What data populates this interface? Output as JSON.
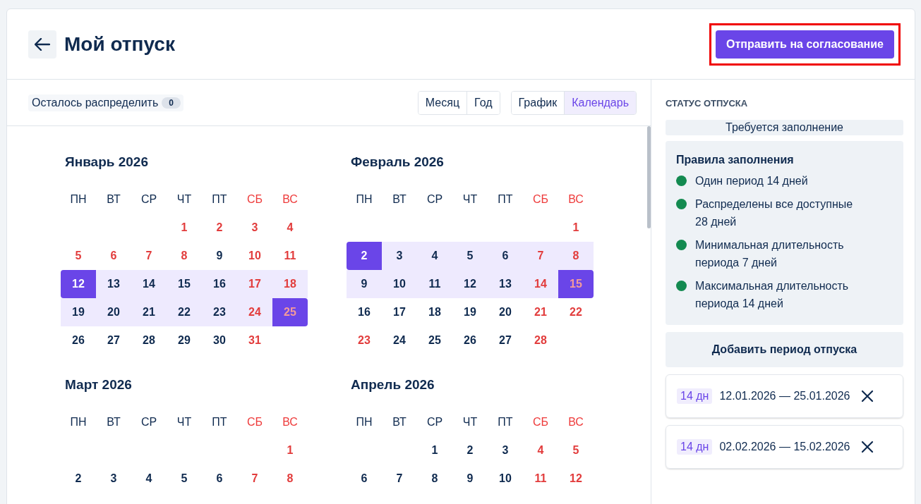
{
  "header": {
    "title": "Мой отпуск",
    "submit_button": "Отправить на согласование",
    "submit_highlighted": true
  },
  "toolbar": {
    "remaining_label": "Осталось распределить",
    "remaining_count": "0",
    "scale_tabs": [
      {
        "label": "Месяц",
        "selected": false
      },
      {
        "label": "Год",
        "selected": false
      }
    ],
    "view_tabs": [
      {
        "label": "График",
        "selected": false
      },
      {
        "label": "Календарь",
        "selected": true
      }
    ]
  },
  "months": [
    {
      "title": "Январь 2026",
      "weekdays": [
        {
          "label": "ПН",
          "weekend": false
        },
        {
          "label": "ВТ",
          "weekend": false
        },
        {
          "label": "СР",
          "weekend": false
        },
        {
          "label": "ЧТ",
          "weekend": false
        },
        {
          "label": "ПТ",
          "weekend": false
        },
        {
          "label": "СБ",
          "weekend": true
        },
        {
          "label": "ВС",
          "weekend": true
        }
      ],
      "weeks": [
        {
          "days": [
            {
              "kind": "blank"
            },
            {
              "kind": "blank"
            },
            {
              "kind": "blank"
            },
            {
              "kind": "day",
              "n": "1",
              "holiday": true,
              "in_range": false,
              "selected": false
            },
            {
              "kind": "day",
              "n": "2",
              "holiday": true,
              "in_range": false,
              "selected": false
            },
            {
              "kind": "day",
              "n": "3",
              "holiday": true,
              "in_range": false,
              "selected": false
            },
            {
              "kind": "day",
              "n": "4",
              "holiday": true,
              "in_range": false,
              "selected": false
            }
          ]
        },
        {
          "days": [
            {
              "kind": "day",
              "n": "5",
              "holiday": true,
              "in_range": false,
              "selected": false
            },
            {
              "kind": "day",
              "n": "6",
              "holiday": true,
              "in_range": false,
              "selected": false
            },
            {
              "kind": "day",
              "n": "7",
              "holiday": true,
              "in_range": false,
              "selected": false
            },
            {
              "kind": "day",
              "n": "8",
              "holiday": true,
              "in_range": false,
              "selected": false
            },
            {
              "kind": "day",
              "n": "9",
              "holiday": false,
              "in_range": false,
              "selected": false
            },
            {
              "kind": "day",
              "n": "10",
              "holiday": true,
              "in_range": false,
              "selected": false
            },
            {
              "kind": "day",
              "n": "11",
              "holiday": true,
              "in_range": false,
              "selected": false
            }
          ]
        },
        {
          "days": [
            {
              "kind": "day",
              "n": "12",
              "holiday": false,
              "in_range": true,
              "selected": true
            },
            {
              "kind": "day",
              "n": "13",
              "holiday": false,
              "in_range": true,
              "selected": false
            },
            {
              "kind": "day",
              "n": "14",
              "holiday": false,
              "in_range": true,
              "selected": false
            },
            {
              "kind": "day",
              "n": "15",
              "holiday": false,
              "in_range": true,
              "selected": false
            },
            {
              "kind": "day",
              "n": "16",
              "holiday": false,
              "in_range": true,
              "selected": false
            },
            {
              "kind": "day",
              "n": "17",
              "holiday": true,
              "in_range": true,
              "selected": false
            },
            {
              "kind": "day",
              "n": "18",
              "holiday": true,
              "in_range": true,
              "selected": false
            }
          ]
        },
        {
          "days": [
            {
              "kind": "day",
              "n": "19",
              "holiday": false,
              "in_range": true,
              "selected": false
            },
            {
              "kind": "day",
              "n": "20",
              "holiday": false,
              "in_range": true,
              "selected": false
            },
            {
              "kind": "day",
              "n": "21",
              "holiday": false,
              "in_range": true,
              "selected": false
            },
            {
              "kind": "day",
              "n": "22",
              "holiday": false,
              "in_range": true,
              "selected": false
            },
            {
              "kind": "day",
              "n": "23",
              "holiday": false,
              "in_range": true,
              "selected": false
            },
            {
              "kind": "day",
              "n": "24",
              "holiday": true,
              "in_range": true,
              "selected": false
            },
            {
              "kind": "day",
              "n": "25",
              "holiday": true,
              "in_range": true,
              "selected": true
            }
          ]
        },
        {
          "days": [
            {
              "kind": "day",
              "n": "26",
              "holiday": false,
              "in_range": false,
              "selected": false
            },
            {
              "kind": "day",
              "n": "27",
              "holiday": false,
              "in_range": false,
              "selected": false
            },
            {
              "kind": "day",
              "n": "28",
              "holiday": false,
              "in_range": false,
              "selected": false
            },
            {
              "kind": "day",
              "n": "29",
              "holiday": false,
              "in_range": false,
              "selected": false
            },
            {
              "kind": "day",
              "n": "30",
              "holiday": false,
              "in_range": false,
              "selected": false
            },
            {
              "kind": "day",
              "n": "31",
              "holiday": true,
              "in_range": false,
              "selected": false
            },
            {
              "kind": "blank"
            }
          ]
        }
      ]
    },
    {
      "title": "Февраль 2026",
      "weekdays": [
        {
          "label": "ПН",
          "weekend": false
        },
        {
          "label": "ВТ",
          "weekend": false
        },
        {
          "label": "СР",
          "weekend": false
        },
        {
          "label": "ЧТ",
          "weekend": false
        },
        {
          "label": "ПТ",
          "weekend": false
        },
        {
          "label": "СБ",
          "weekend": true
        },
        {
          "label": "ВС",
          "weekend": true
        }
      ],
      "weeks": [
        {
          "days": [
            {
              "kind": "blank"
            },
            {
              "kind": "blank"
            },
            {
              "kind": "blank"
            },
            {
              "kind": "blank"
            },
            {
              "kind": "blank"
            },
            {
              "kind": "blank"
            },
            {
              "kind": "day",
              "n": "1",
              "holiday": true,
              "in_range": false,
              "selected": false
            }
          ]
        },
        {
          "days": [
            {
              "kind": "day",
              "n": "2",
              "holiday": false,
              "in_range": true,
              "selected": true
            },
            {
              "kind": "day",
              "n": "3",
              "holiday": false,
              "in_range": true,
              "selected": false
            },
            {
              "kind": "day",
              "n": "4",
              "holiday": false,
              "in_range": true,
              "selected": false
            },
            {
              "kind": "day",
              "n": "5",
              "holiday": false,
              "in_range": true,
              "selected": false
            },
            {
              "kind": "day",
              "n": "6",
              "holiday": false,
              "in_range": true,
              "selected": false
            },
            {
              "kind": "day",
              "n": "7",
              "holiday": true,
              "in_range": true,
              "selected": false
            },
            {
              "kind": "day",
              "n": "8",
              "holiday": true,
              "in_range": true,
              "selected": false
            }
          ]
        },
        {
          "days": [
            {
              "kind": "day",
              "n": "9",
              "holiday": false,
              "in_range": true,
              "selected": false
            },
            {
              "kind": "day",
              "n": "10",
              "holiday": false,
              "in_range": true,
              "selected": false
            },
            {
              "kind": "day",
              "n": "11",
              "holiday": false,
              "in_range": true,
              "selected": false
            },
            {
              "kind": "day",
              "n": "12",
              "holiday": false,
              "in_range": true,
              "selected": false
            },
            {
              "kind": "day",
              "n": "13",
              "holiday": false,
              "in_range": true,
              "selected": false
            },
            {
              "kind": "day",
              "n": "14",
              "holiday": true,
              "in_range": true,
              "selected": false
            },
            {
              "kind": "day",
              "n": "15",
              "holiday": true,
              "in_range": true,
              "selected": true
            }
          ]
        },
        {
          "days": [
            {
              "kind": "day",
              "n": "16",
              "holiday": false,
              "in_range": false,
              "selected": false
            },
            {
              "kind": "day",
              "n": "17",
              "holiday": false,
              "in_range": false,
              "selected": false
            },
            {
              "kind": "day",
              "n": "18",
              "holiday": false,
              "in_range": false,
              "selected": false
            },
            {
              "kind": "day",
              "n": "19",
              "holiday": false,
              "in_range": false,
              "selected": false
            },
            {
              "kind": "day",
              "n": "20",
              "holiday": false,
              "in_range": false,
              "selected": false
            },
            {
              "kind": "day",
              "n": "21",
              "holiday": true,
              "in_range": false,
              "selected": false
            },
            {
              "kind": "day",
              "n": "22",
              "holiday": true,
              "in_range": false,
              "selected": false
            }
          ]
        },
        {
          "days": [
            {
              "kind": "day",
              "n": "23",
              "holiday": true,
              "in_range": false,
              "selected": false
            },
            {
              "kind": "day",
              "n": "24",
              "holiday": false,
              "in_range": false,
              "selected": false
            },
            {
              "kind": "day",
              "n": "25",
              "holiday": false,
              "in_range": false,
              "selected": false
            },
            {
              "kind": "day",
              "n": "26",
              "holiday": false,
              "in_range": false,
              "selected": false
            },
            {
              "kind": "day",
              "n": "27",
              "holiday": false,
              "in_range": false,
              "selected": false
            },
            {
              "kind": "day",
              "n": "28",
              "holiday": true,
              "in_range": false,
              "selected": false
            },
            {
              "kind": "blank"
            }
          ]
        }
      ]
    },
    {
      "title": "Март 2026",
      "weekdays": [
        {
          "label": "ПН",
          "weekend": false
        },
        {
          "label": "ВТ",
          "weekend": false
        },
        {
          "label": "СР",
          "weekend": false
        },
        {
          "label": "ЧТ",
          "weekend": false
        },
        {
          "label": "ПТ",
          "weekend": false
        },
        {
          "label": "СБ",
          "weekend": true
        },
        {
          "label": "ВС",
          "weekend": true
        }
      ],
      "weeks": [
        {
          "days": [
            {
              "kind": "blank"
            },
            {
              "kind": "blank"
            },
            {
              "kind": "blank"
            },
            {
              "kind": "blank"
            },
            {
              "kind": "blank"
            },
            {
              "kind": "blank"
            },
            {
              "kind": "day",
              "n": "1",
              "holiday": true,
              "in_range": false,
              "selected": false
            }
          ]
        },
        {
          "days": [
            {
              "kind": "day",
              "n": "2",
              "holiday": false,
              "in_range": false,
              "selected": false
            },
            {
              "kind": "day",
              "n": "3",
              "holiday": false,
              "in_range": false,
              "selected": false
            },
            {
              "kind": "day",
              "n": "4",
              "holiday": false,
              "in_range": false,
              "selected": false
            },
            {
              "kind": "day",
              "n": "5",
              "holiday": false,
              "in_range": false,
              "selected": false
            },
            {
              "kind": "day",
              "n": "6",
              "holiday": false,
              "in_range": false,
              "selected": false
            },
            {
              "kind": "day",
              "n": "7",
              "holiday": true,
              "in_range": false,
              "selected": false
            },
            {
              "kind": "day",
              "n": "8",
              "holiday": true,
              "in_range": false,
              "selected": false
            }
          ]
        }
      ]
    },
    {
      "title": "Апрель 2026",
      "weekdays": [
        {
          "label": "ПН",
          "weekend": false
        },
        {
          "label": "ВТ",
          "weekend": false
        },
        {
          "label": "СР",
          "weekend": false
        },
        {
          "label": "ЧТ",
          "weekend": false
        },
        {
          "label": "ПТ",
          "weekend": false
        },
        {
          "label": "СБ",
          "weekend": true
        },
        {
          "label": "ВС",
          "weekend": true
        }
      ],
      "weeks": [
        {
          "days": [
            {
              "kind": "blank"
            },
            {
              "kind": "blank"
            },
            {
              "kind": "day",
              "n": "1",
              "holiday": false,
              "in_range": false,
              "selected": false
            },
            {
              "kind": "day",
              "n": "2",
              "holiday": false,
              "in_range": false,
              "selected": false
            },
            {
              "kind": "day",
              "n": "3",
              "holiday": false,
              "in_range": false,
              "selected": false
            },
            {
              "kind": "day",
              "n": "4",
              "holiday": true,
              "in_range": false,
              "selected": false
            },
            {
              "kind": "day",
              "n": "5",
              "holiday": true,
              "in_range": false,
              "selected": false
            }
          ]
        },
        {
          "days": [
            {
              "kind": "day",
              "n": "6",
              "holiday": false,
              "in_range": false,
              "selected": false
            },
            {
              "kind": "day",
              "n": "7",
              "holiday": false,
              "in_range": false,
              "selected": false
            },
            {
              "kind": "day",
              "n": "8",
              "holiday": false,
              "in_range": false,
              "selected": false
            },
            {
              "kind": "day",
              "n": "9",
              "holiday": false,
              "in_range": false,
              "selected": false
            },
            {
              "kind": "day",
              "n": "10",
              "holiday": false,
              "in_range": false,
              "selected": false
            },
            {
              "kind": "day",
              "n": "11",
              "holiday": true,
              "in_range": false,
              "selected": false
            },
            {
              "kind": "day",
              "n": "12",
              "holiday": true,
              "in_range": false,
              "selected": false
            }
          ]
        }
      ]
    }
  ],
  "status_panel": {
    "heading": "СТАТУС ОТПУСКА",
    "status": "Требуется заполнение",
    "rules_title": "Правила заполнения",
    "rules": [
      {
        "text": "Один период 14 дней",
        "done": true
      },
      {
        "text": "Распределены все доступные 28 дней",
        "done": true
      },
      {
        "text": "Минимальная длительность периода 7 дней",
        "done": true
      },
      {
        "text": "Максимальная длительность периода 14 дней",
        "done": true
      }
    ],
    "add_button": "Добавить период отпуска",
    "periods": [
      {
        "days": "14 дн",
        "dates": "12.01.2026 — 25.01.2026"
      },
      {
        "days": "14 дн",
        "dates": "02.02.2026 — 15.02.2026"
      }
    ]
  }
}
